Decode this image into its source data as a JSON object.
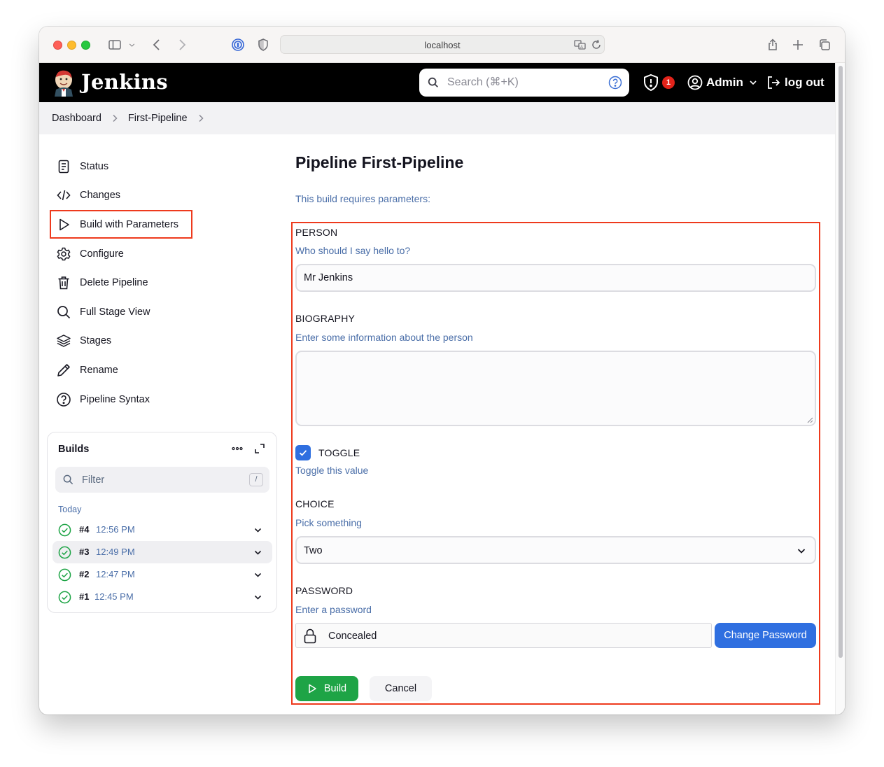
{
  "browser": {
    "address": "localhost"
  },
  "header": {
    "brand": "Jenkins",
    "search_placeholder": "Search (⌘+K)",
    "alert_count": "1",
    "user": "Admin",
    "logout": "log out"
  },
  "breadcrumb": {
    "items": [
      "Dashboard",
      "First-Pipeline"
    ]
  },
  "sidebar": {
    "items": [
      {
        "label": "Status",
        "icon": "document-icon"
      },
      {
        "label": "Changes",
        "icon": "code-icon"
      },
      {
        "label": "Build with Parameters",
        "icon": "play-icon"
      },
      {
        "label": "Configure",
        "icon": "gear-icon"
      },
      {
        "label": "Delete Pipeline",
        "icon": "trash-icon"
      },
      {
        "label": "Full Stage View",
        "icon": "search-icon"
      },
      {
        "label": "Stages",
        "icon": "layers-icon"
      },
      {
        "label": "Rename",
        "icon": "pencil-icon"
      },
      {
        "label": "Pipeline Syntax",
        "icon": "help-icon"
      }
    ]
  },
  "builds": {
    "title": "Builds",
    "filter_placeholder": "Filter",
    "filter_key": "/",
    "group": "Today",
    "items": [
      {
        "number": "#4",
        "time": "12:56 PM",
        "status": "success"
      },
      {
        "number": "#3",
        "time": "12:49 PM",
        "status": "success"
      },
      {
        "number": "#2",
        "time": "12:47 PM",
        "status": "success"
      },
      {
        "number": "#1",
        "time": "12:45 PM",
        "status": "success"
      }
    ]
  },
  "main": {
    "title": "Pipeline First-Pipeline",
    "intro": "This build requires parameters:",
    "params": {
      "person": {
        "label": "PERSON",
        "description": "Who should I say hello to?",
        "value": "Mr Jenkins"
      },
      "biography": {
        "label": "BIOGRAPHY",
        "description": "Enter some information about the person",
        "value": ""
      },
      "toggle": {
        "label": "TOGGLE",
        "description": "Toggle this value",
        "checked": true
      },
      "choice": {
        "label": "CHOICE",
        "description": "Pick something",
        "value": "Two"
      },
      "password": {
        "label": "PASSWORD",
        "description": "Enter a password",
        "value": "Concealed",
        "change_label": "Change Password"
      }
    },
    "build_label": "Build",
    "cancel_label": "Cancel"
  },
  "colors": {
    "accent": "#2f6fe0",
    "success": "#1ea446",
    "highlight": "#ee3a1d",
    "link": "#4a6ea8"
  }
}
